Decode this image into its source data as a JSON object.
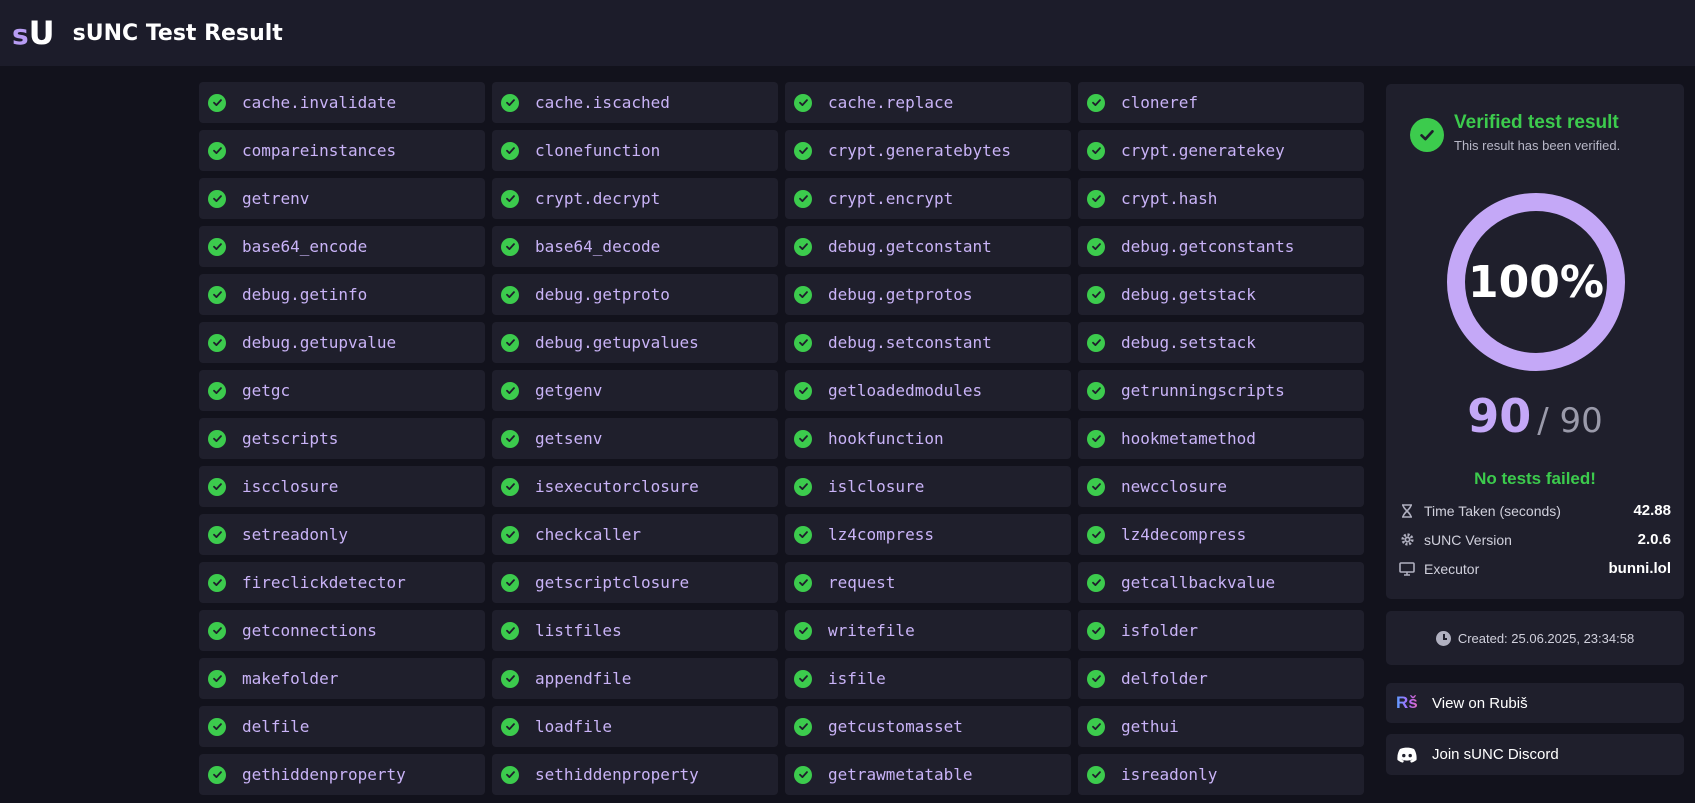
{
  "header": {
    "logo_s": "s",
    "logo_u": "U",
    "title": "sUNC Test Result"
  },
  "functions": [
    "cache.invalidate",
    "cache.iscached",
    "cache.replace",
    "cloneref",
    "compareinstances",
    "clonefunction",
    "crypt.generatebytes",
    "crypt.generatekey",
    "getrenv",
    "crypt.decrypt",
    "crypt.encrypt",
    "crypt.hash",
    "base64_encode",
    "base64_decode",
    "debug.getconstant",
    "debug.getconstants",
    "debug.getinfo",
    "debug.getproto",
    "debug.getprotos",
    "debug.getstack",
    "debug.getupvalue",
    "debug.getupvalues",
    "debug.setconstant",
    "debug.setstack",
    "getgc",
    "getgenv",
    "getloadedmodules",
    "getrunningscripts",
    "getscripts",
    "getsenv",
    "hookfunction",
    "hookmetamethod",
    "iscclosure",
    "isexecutorclosure",
    "islclosure",
    "newcclosure",
    "setreadonly",
    "checkcaller",
    "lz4compress",
    "lz4decompress",
    "fireclickdetector",
    "getscriptclosure",
    "request",
    "getcallbackvalue",
    "getconnections",
    "listfiles",
    "writefile",
    "isfolder",
    "makefolder",
    "appendfile",
    "isfile",
    "delfolder",
    "delfile",
    "loadfile",
    "getcustomasset",
    "gethui",
    "gethiddenproperty",
    "sethiddenproperty",
    "getrawmetatable",
    "isreadonly"
  ],
  "result": {
    "verified_title": "Verified test result",
    "verified_subtitle": "This result has been verified.",
    "percent_text": "100%",
    "percent_value": 1.0,
    "passed": "90",
    "total_text": "/ 90",
    "status": "No tests failed!",
    "stats": [
      {
        "icon": "hourglass-icon",
        "label": "Time Taken (seconds)",
        "value": "42.88"
      },
      {
        "icon": "gear-icon",
        "label": "sUNC Version",
        "value": "2.0.6"
      },
      {
        "icon": "monitor-icon",
        "label": "Executor",
        "value": "bunni.lol"
      }
    ]
  },
  "created": "Created: 25.06.2025, 23:34:58",
  "links": {
    "rubis_icon_text": "Rš",
    "rubis": "View on Rubiš",
    "discord": "Join sUNC Discord"
  },
  "colors": {
    "accent": "#c4a8f7",
    "success": "#3ccb4d",
    "background": "#12121c",
    "card": "#1f1f2c"
  }
}
